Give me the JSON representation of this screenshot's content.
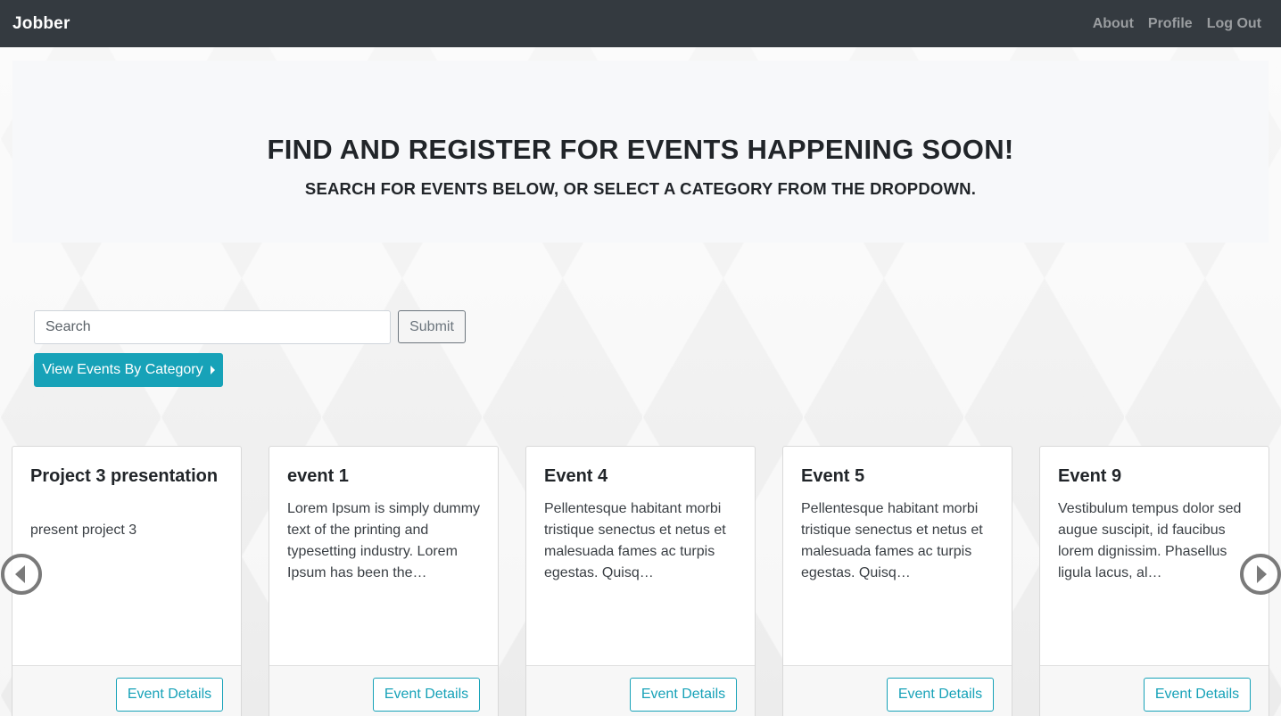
{
  "navbar": {
    "brand": "Jobber",
    "links": [
      {
        "label": "About"
      },
      {
        "label": "Profile"
      },
      {
        "label": "Log Out"
      }
    ]
  },
  "hero": {
    "title": "FIND AND REGISTER FOR EVENTS HAPPENING SOON!",
    "subtitle": "SEARCH FOR EVENTS BELOW, OR SELECT A CATEGORY FROM THE DROPDOWN."
  },
  "search": {
    "placeholder": "Search",
    "value": "",
    "submit_label": "Submit"
  },
  "category_button": {
    "label": "View Events By Category",
    "icon": "caret-right-icon"
  },
  "carousel": {
    "prev_icon": "chevron-left-circle-icon",
    "next_icon": "chevron-right-circle-icon",
    "cards": [
      {
        "title": "Project 3 presentation",
        "description": "present project 3",
        "button_label": "Event Details"
      },
      {
        "title": "event 1",
        "description": "Lorem Ipsum is simply dummy text of the printing and typesetting industry. Lorem Ipsum has been the…",
        "button_label": "Event Details"
      },
      {
        "title": "Event 4",
        "description": "Pellentesque habitant morbi tristique senectus et netus et malesuada fames ac turpis egestas. Quisq…",
        "button_label": "Event Details"
      },
      {
        "title": "Event 5",
        "description": "Pellentesque habitant morbi tristique senectus et netus et malesuada fames ac turpis egestas. Quisq…",
        "button_label": "Event Details"
      },
      {
        "title": "Event 9",
        "description": "Vestibulum tempus dolor sed augue suscipit, id faucibus lorem dignissim. Phasellus ligula lacus, al…",
        "button_label": "Event Details"
      }
    ]
  },
  "colors": {
    "navbar_bg": "#343a40",
    "accent": "#17a2b8",
    "nav_link": "#9a9da0"
  }
}
